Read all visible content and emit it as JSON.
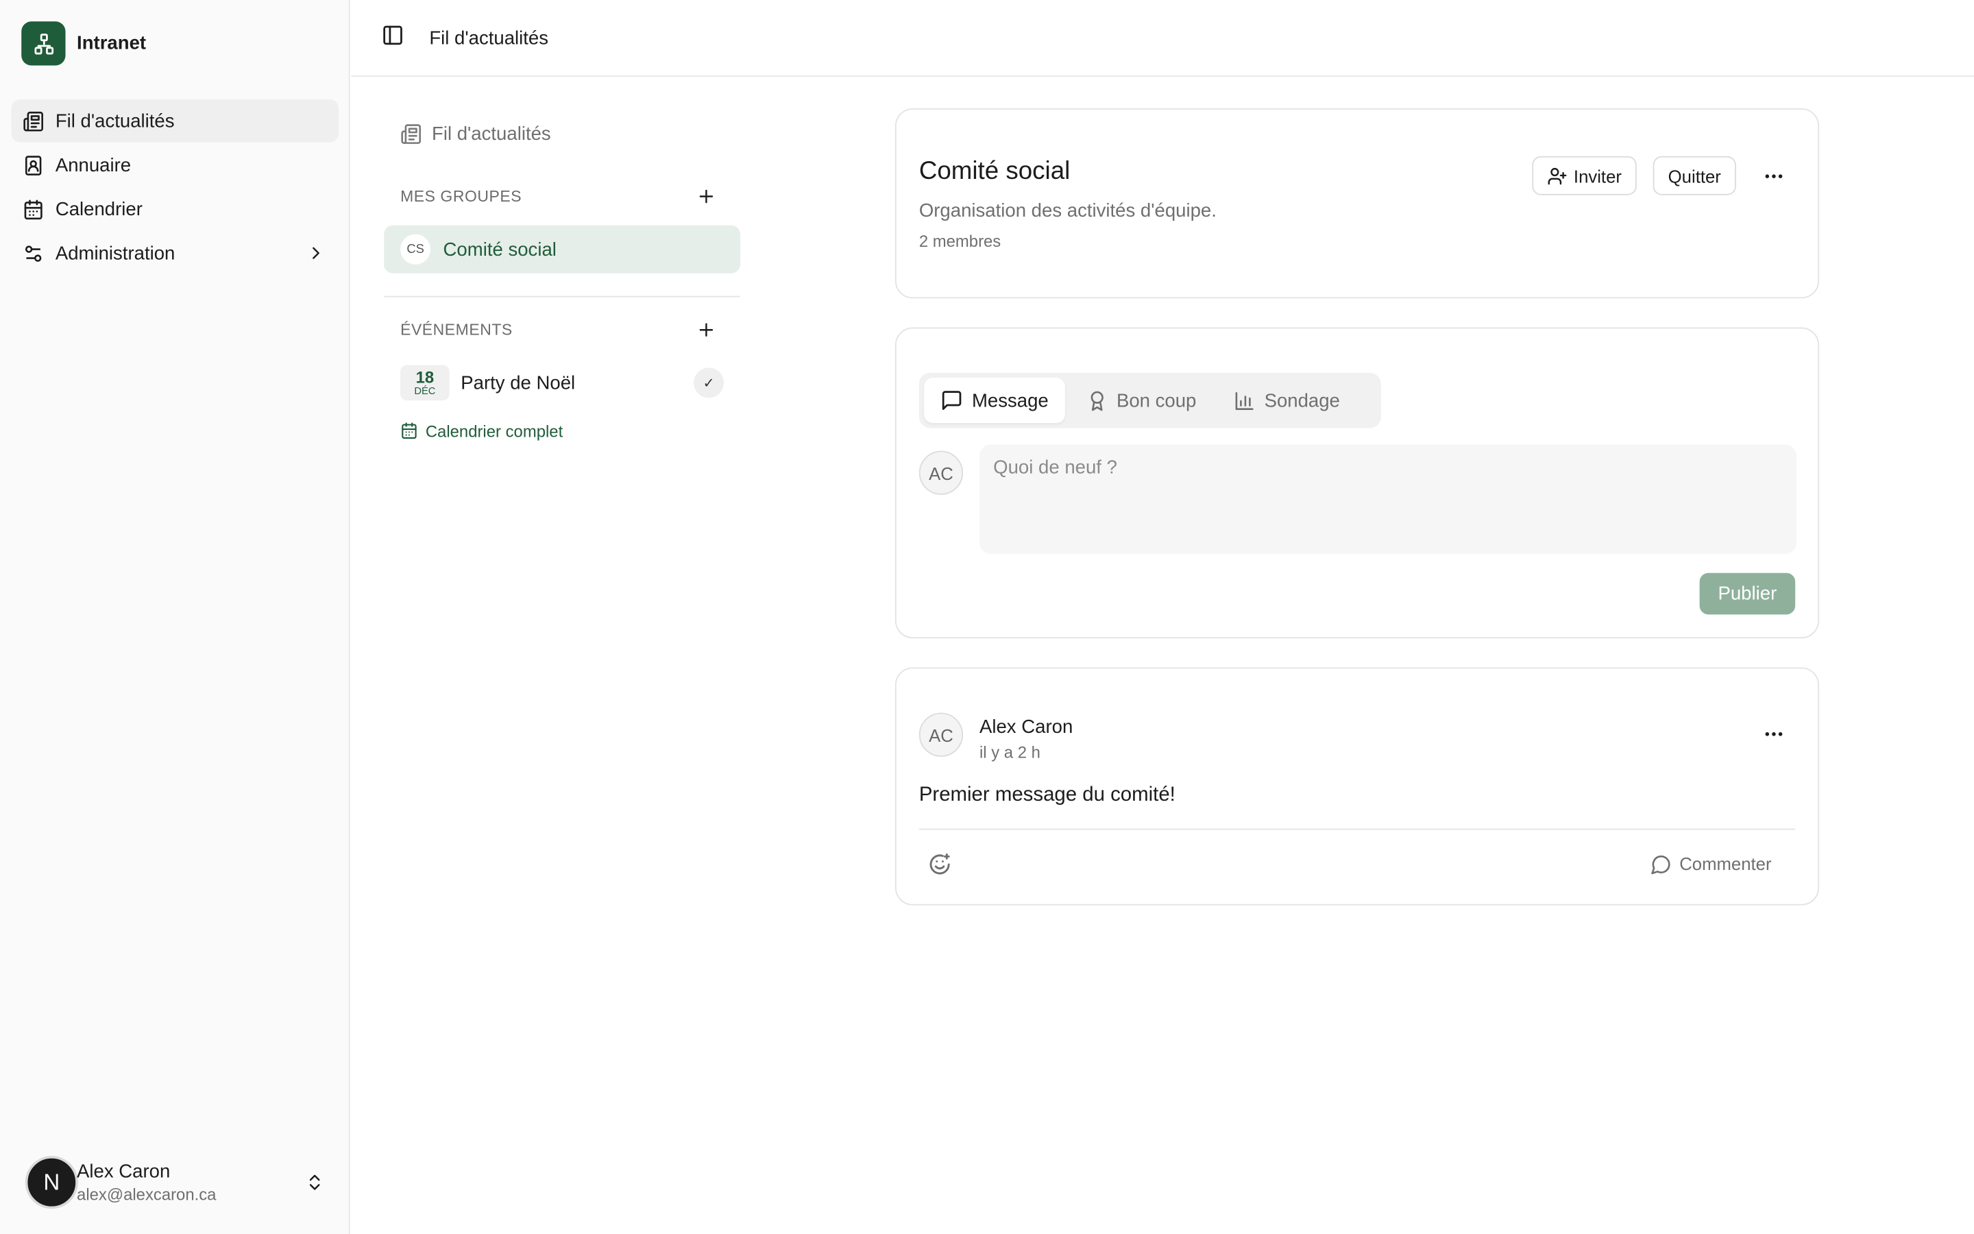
{
  "app": {
    "name": "Intranet"
  },
  "sidebar": {
    "items": [
      {
        "label": "Fil d'actualités",
        "icon": "newspaper-icon",
        "active": true
      },
      {
        "label": "Annuaire",
        "icon": "contact-book-icon"
      },
      {
        "label": "Calendrier",
        "icon": "calendar-icon"
      },
      {
        "label": "Administration",
        "icon": "settings-sliders-icon"
      }
    ],
    "user": {
      "initial": "N",
      "name": "Alex Caron",
      "email": "alex@alexcaron.ca"
    }
  },
  "topbar": {
    "breadcrumb": "Fil d'actualités"
  },
  "groups_panel": {
    "feed_link": "Fil d'actualités",
    "my_groups_heading": "MES GROUPES",
    "groups": [
      {
        "initials": "CS",
        "name": "Comité social"
      }
    ],
    "events_heading": "ÉVÉNEMENTS",
    "events": [
      {
        "day": "18",
        "month": "DÉC",
        "name": "Party de Noël",
        "status": "✓"
      }
    ],
    "calendar_link": "Calendrier complet"
  },
  "group": {
    "title": "Comité social",
    "description": "Organisation des activités d'équipe.",
    "members": "2 membres",
    "invite_label": "Inviter",
    "quit_label": "Quitter"
  },
  "composer": {
    "tabs": [
      {
        "label": "Message",
        "icon": "message-icon",
        "active": true
      },
      {
        "label": "Bon coup",
        "icon": "award-icon"
      },
      {
        "label": "Sondage",
        "icon": "bar-chart-icon"
      }
    ],
    "avatar_initials": "AC",
    "placeholder": "Quoi de neuf ?",
    "publish_label": "Publier"
  },
  "post": {
    "avatar_initials": "AC",
    "author": "Alex Caron",
    "time": "il y a 2 h",
    "body": "Premier message du comité!",
    "comment_label": "Commenter"
  },
  "colors": {
    "brand": "#1f5c3a",
    "brand_light": "#e6eee9",
    "publish_disabled": "#8fb19c"
  }
}
